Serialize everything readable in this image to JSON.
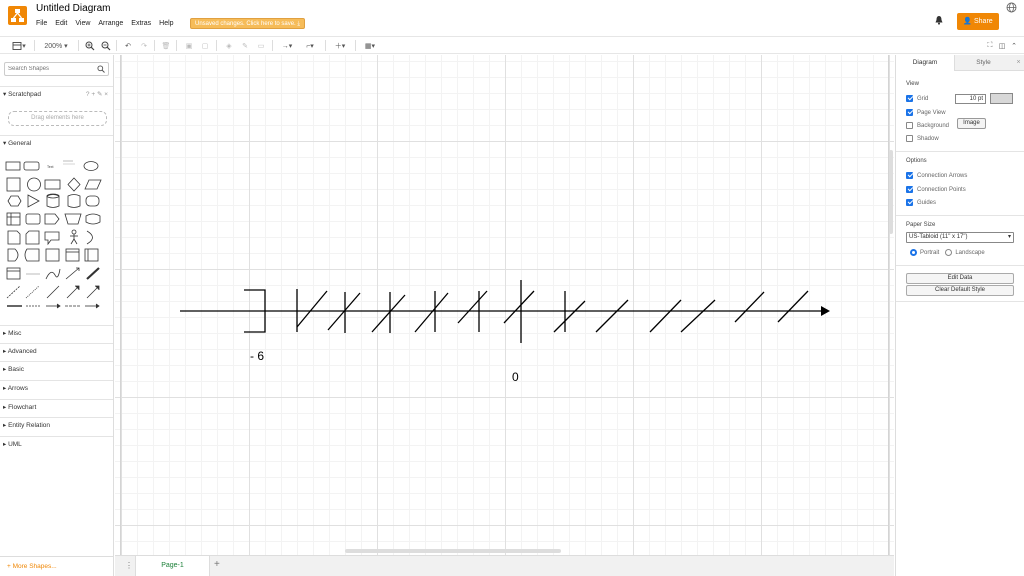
{
  "app": {
    "title": "Untitled Diagram",
    "unsaved_notice": "Unsaved changes. Click here to save.",
    "share_label": "Share",
    "brand_color": "#f08705",
    "menu": [
      "File",
      "Edit",
      "View",
      "Arrange",
      "Extras",
      "Help"
    ]
  },
  "toolbar": {
    "zoom": "200%"
  },
  "left_panel": {
    "search_placeholder": "Search Shapes",
    "scratchpad_label": "Scratchpad",
    "scratchpad_icons": "? + ✎ ×",
    "drag_hint": "Drag elements here",
    "general_label": "General",
    "sections": [
      "Misc",
      "Advanced",
      "Basic",
      "Arrows",
      "Flowchart",
      "Entity Relation",
      "UML"
    ],
    "more_shapes": "More Shapes..."
  },
  "canvas": {
    "labels": {
      "left": "- 6",
      "zero": "0"
    }
  },
  "bottom": {
    "page_tab": "Page-1"
  },
  "right_panel": {
    "tabs": {
      "diagram": "Diagram",
      "style": "Style"
    },
    "view": {
      "title": "View",
      "grid": {
        "label": "Grid",
        "checked": true,
        "size": "10 pt"
      },
      "page_view": {
        "label": "Page View",
        "checked": true
      },
      "background": {
        "label": "Background",
        "checked": false,
        "button": "Image"
      },
      "shadow": {
        "label": "Shadow",
        "checked": false
      }
    },
    "options": {
      "title": "Options",
      "connection_arrows": {
        "label": "Connection Arrows",
        "checked": true
      },
      "connection_points": {
        "label": "Connection Points",
        "checked": true
      },
      "guides": {
        "label": "Guides",
        "checked": true
      }
    },
    "paper": {
      "title": "Paper Size",
      "selected": "US-Tabloid (11\" x 17\")",
      "portrait": "Portrait",
      "landscape": "Landscape",
      "orientation": "portrait"
    },
    "buttons": {
      "edit_data": "Edit Data",
      "clear_style": "Clear Default Style"
    }
  }
}
